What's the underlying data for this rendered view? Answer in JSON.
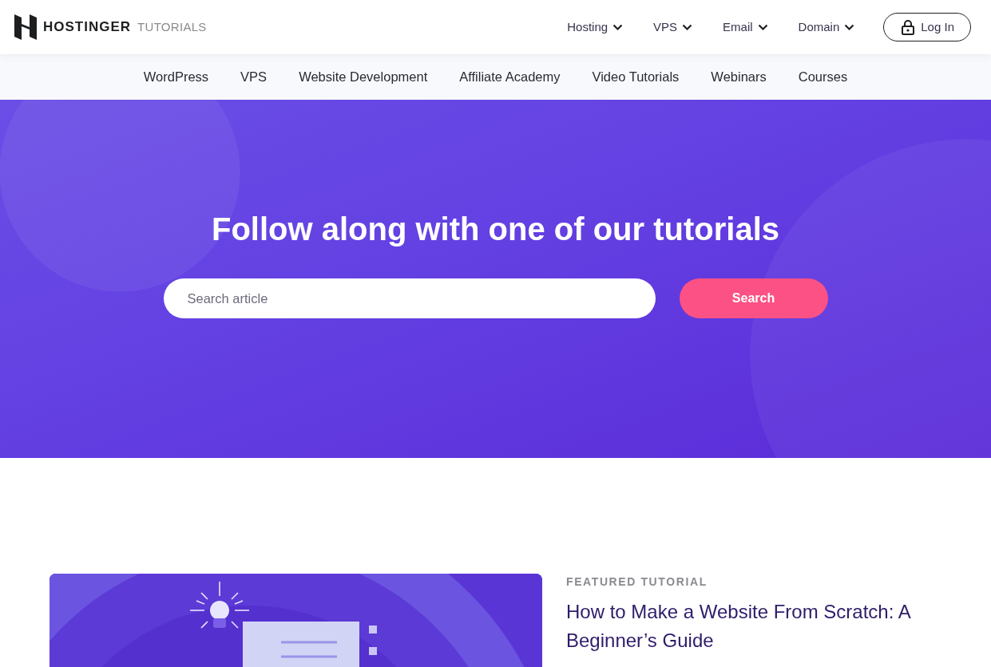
{
  "logo": {
    "brand": "HOSTINGER",
    "section": "TUTORIALS"
  },
  "top_nav": [
    {
      "label": "Hosting",
      "has_dropdown": true
    },
    {
      "label": "VPS",
      "has_dropdown": true
    },
    {
      "label": "Email",
      "has_dropdown": true
    },
    {
      "label": "Domain",
      "has_dropdown": true
    }
  ],
  "login_button": {
    "label": "Log In"
  },
  "category_nav": [
    "WordPress",
    "VPS",
    "Website Development",
    "Affiliate Academy",
    "Video Tutorials",
    "Webinars",
    "Courses"
  ],
  "hero": {
    "title": "Follow along with one of our tutorials",
    "search": {
      "placeholder": "Search article"
    },
    "search_button": "Search"
  },
  "featured": {
    "eyebrow": "FEATURED TUTORIAL",
    "title": "How to Make a Website From Scratch: A Beginner’s Guide"
  }
}
